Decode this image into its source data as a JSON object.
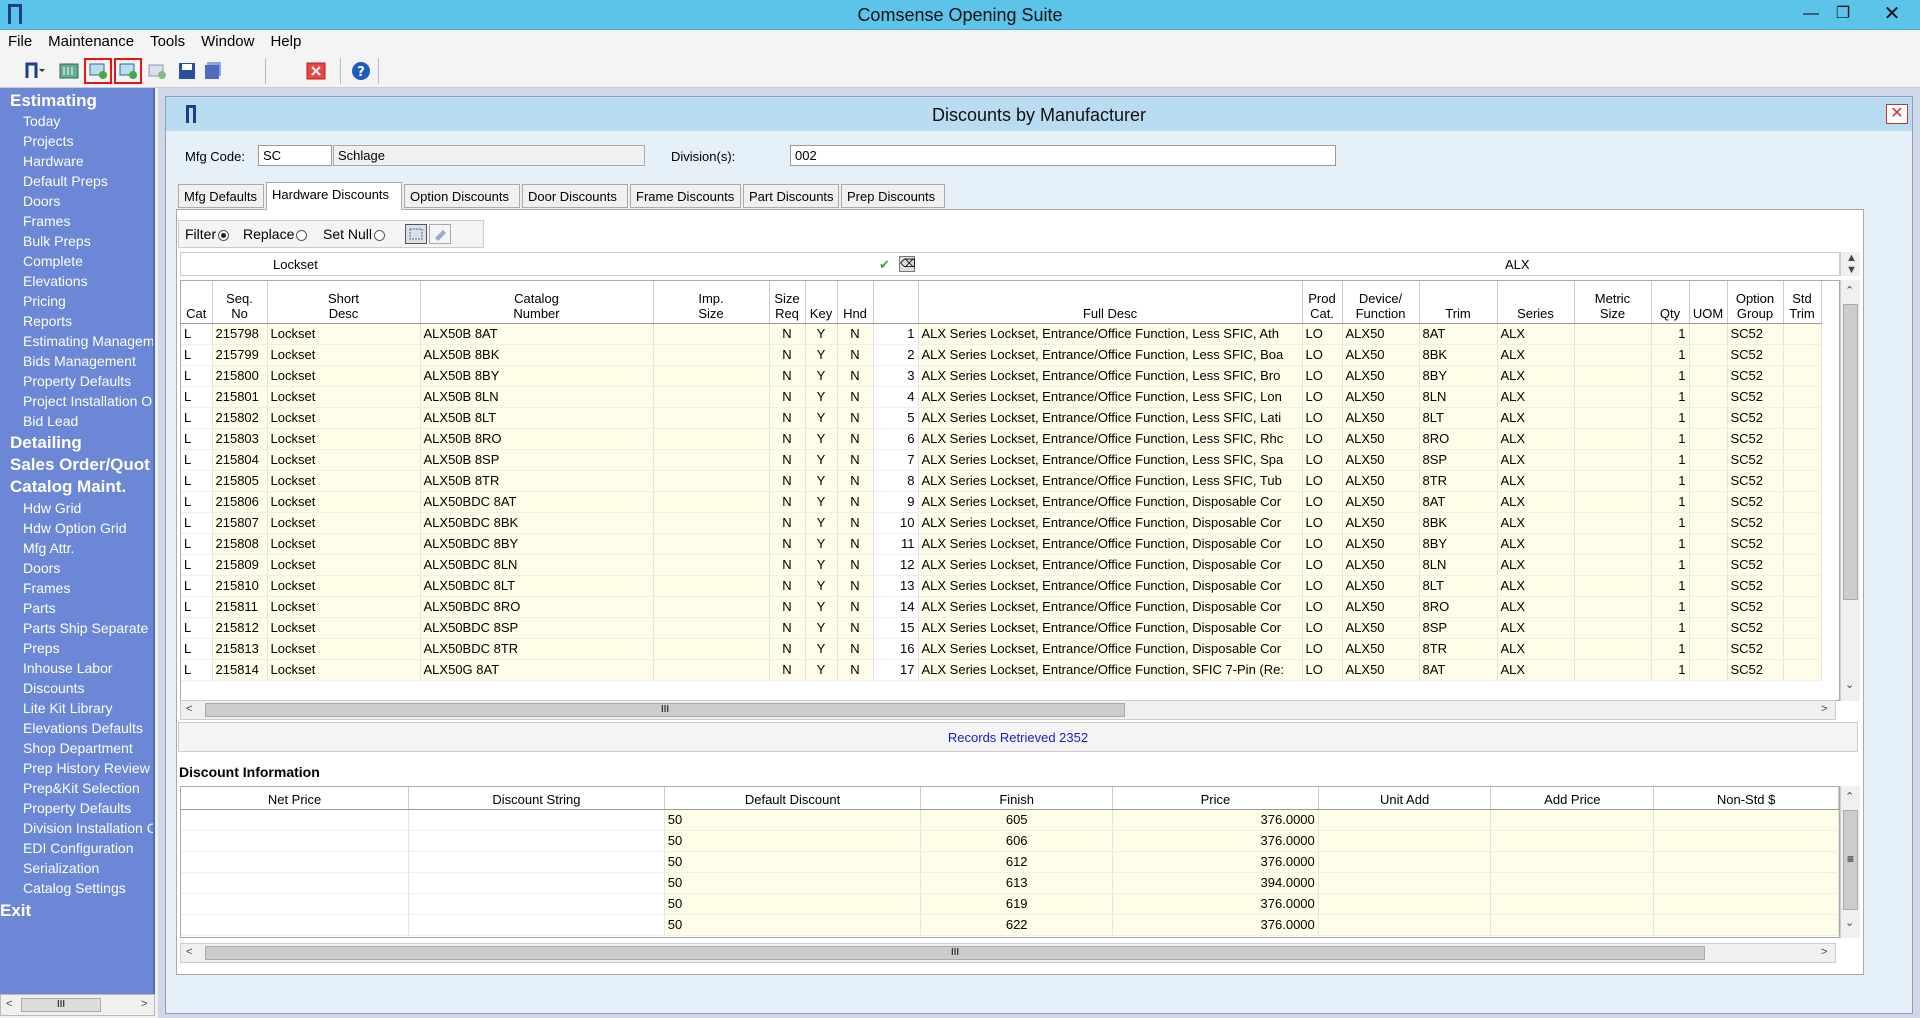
{
  "app": {
    "title": "Comsense Opening Suite"
  },
  "menu": [
    "File",
    "Maintenance",
    "Tools",
    "Window",
    "Help"
  ],
  "sidebar": {
    "estimating": {
      "label": "Estimating",
      "items": [
        "Today",
        "Projects",
        "Hardware",
        "Default Preps",
        "Doors",
        "Frames",
        "Bulk Preps",
        "Complete",
        "Elevations",
        "Pricing",
        "Reports",
        "Estimating Manageme",
        "Bids Management",
        "Property Defaults",
        "Project Installation O|",
        "Bid Lead"
      ]
    },
    "detailing": "Detailing",
    "sales": "Sales Order/Quot",
    "catalog": {
      "label": "Catalog Maint.",
      "items": [
        "Hdw Grid",
        "Hdw Option Grid",
        "Mfg Attr.",
        "Doors",
        "Frames",
        "Parts",
        "Parts Ship Separate",
        "Preps",
        "Inhouse Labor",
        "Discounts",
        "Lite Kit Library",
        "Elevations Defaults",
        "Shop Department",
        "Prep History Review",
        "Prep&Kit Selection",
        "Property Defaults",
        "Division Installation O",
        "EDI Configuration",
        "Serialization",
        "Catalog Settings"
      ]
    },
    "exit": "Exit"
  },
  "window": {
    "title": "Discounts by Manufacturer"
  },
  "form": {
    "mfg_code_label": "Mfg Code:",
    "mfg_code": "SC",
    "mfg_name": "Schlage",
    "division_label": "Division(s):",
    "division": "002"
  },
  "tabs": [
    "Mfg Defaults",
    "Hardware Discounts",
    "Option Discounts",
    "Door Discounts",
    "Frame Discounts",
    "Part Discounts",
    "Prep Discounts"
  ],
  "filterbar": {
    "filter": "Filter",
    "replace": "Replace",
    "setnull": "Set Null"
  },
  "filter_row": {
    "short_desc": "Lockset",
    "series": "ALX"
  },
  "grid": {
    "headers": [
      "Cat",
      "Seq.\nNo",
      "Short\nDesc",
      "Catalog\nNumber",
      "Imp.\nSize",
      "Size\nReq",
      "Key",
      "Hnd",
      "",
      "Full Desc",
      "Prod\nCat.",
      "Device/\nFunction",
      "Trim",
      "Series",
      "Metric\nSize",
      "Qty",
      "UOM",
      "Option\nGroup",
      "Std\nTrim"
    ],
    "rows": [
      [
        "L",
        "215798",
        "Lockset",
        "ALX50B 8AT",
        "",
        "N",
        "Y",
        "N",
        "1",
        "ALX Series Lockset, Entrance/Office Function, Less SFIC, Ath",
        "LO",
        "ALX50",
        "8AT",
        "ALX",
        "",
        "1",
        "",
        "SC52",
        ""
      ],
      [
        "L",
        "215799",
        "Lockset",
        "ALX50B 8BK",
        "",
        "N",
        "Y",
        "N",
        "2",
        "ALX Series Lockset, Entrance/Office Function, Less SFIC, Boa",
        "LO",
        "ALX50",
        "8BK",
        "ALX",
        "",
        "1",
        "",
        "SC52",
        ""
      ],
      [
        "L",
        "215800",
        "Lockset",
        "ALX50B 8BY",
        "",
        "N",
        "Y",
        "N",
        "3",
        "ALX Series Lockset, Entrance/Office Function, Less SFIC, Bro",
        "LO",
        "ALX50",
        "8BY",
        "ALX",
        "",
        "1",
        "",
        "SC52",
        ""
      ],
      [
        "L",
        "215801",
        "Lockset",
        "ALX50B 8LN",
        "",
        "N",
        "Y",
        "N",
        "4",
        "ALX Series Lockset, Entrance/Office Function, Less SFIC, Lon",
        "LO",
        "ALX50",
        "8LN",
        "ALX",
        "",
        "1",
        "",
        "SC52",
        ""
      ],
      [
        "L",
        "215802",
        "Lockset",
        "ALX50B 8LT",
        "",
        "N",
        "Y",
        "N",
        "5",
        "ALX Series Lockset, Entrance/Office Function, Less SFIC, Lati",
        "LO",
        "ALX50",
        "8LT",
        "ALX",
        "",
        "1",
        "",
        "SC52",
        ""
      ],
      [
        "L",
        "215803",
        "Lockset",
        "ALX50B 8RO",
        "",
        "N",
        "Y",
        "N",
        "6",
        "ALX Series Lockset, Entrance/Office Function, Less SFIC, Rhc",
        "LO",
        "ALX50",
        "8RO",
        "ALX",
        "",
        "1",
        "",
        "SC52",
        ""
      ],
      [
        "L",
        "215804",
        "Lockset",
        "ALX50B 8SP",
        "",
        "N",
        "Y",
        "N",
        "7",
        "ALX Series Lockset, Entrance/Office Function, Less SFIC, Spa",
        "LO",
        "ALX50",
        "8SP",
        "ALX",
        "",
        "1",
        "",
        "SC52",
        ""
      ],
      [
        "L",
        "215805",
        "Lockset",
        "ALX50B 8TR",
        "",
        "N",
        "Y",
        "N",
        "8",
        "ALX Series Lockset, Entrance/Office Function, Less SFIC, Tub",
        "LO",
        "ALX50",
        "8TR",
        "ALX",
        "",
        "1",
        "",
        "SC52",
        ""
      ],
      [
        "L",
        "215806",
        "Lockset",
        "ALX50BDC 8AT",
        "",
        "N",
        "Y",
        "N",
        "9",
        "ALX Series Lockset, Entrance/Office Function, Disposable Cor",
        "LO",
        "ALX50",
        "8AT",
        "ALX",
        "",
        "1",
        "",
        "SC52",
        ""
      ],
      [
        "L",
        "215807",
        "Lockset",
        "ALX50BDC 8BK",
        "",
        "N",
        "Y",
        "N",
        "10",
        "ALX Series Lockset, Entrance/Office Function, Disposable Cor",
        "LO",
        "ALX50",
        "8BK",
        "ALX",
        "",
        "1",
        "",
        "SC52",
        ""
      ],
      [
        "L",
        "215808",
        "Lockset",
        "ALX50BDC 8BY",
        "",
        "N",
        "Y",
        "N",
        "11",
        "ALX Series Lockset, Entrance/Office Function, Disposable Cor",
        "LO",
        "ALX50",
        "8BY",
        "ALX",
        "",
        "1",
        "",
        "SC52",
        ""
      ],
      [
        "L",
        "215809",
        "Lockset",
        "ALX50BDC 8LN",
        "",
        "N",
        "Y",
        "N",
        "12",
        "ALX Series Lockset, Entrance/Office Function, Disposable Cor",
        "LO",
        "ALX50",
        "8LN",
        "ALX",
        "",
        "1",
        "",
        "SC52",
        ""
      ],
      [
        "L",
        "215810",
        "Lockset",
        "ALX50BDC 8LT",
        "",
        "N",
        "Y",
        "N",
        "13",
        "ALX Series Lockset, Entrance/Office Function, Disposable Cor",
        "LO",
        "ALX50",
        "8LT",
        "ALX",
        "",
        "1",
        "",
        "SC52",
        ""
      ],
      [
        "L",
        "215811",
        "Lockset",
        "ALX50BDC 8RO",
        "",
        "N",
        "Y",
        "N",
        "14",
        "ALX Series Lockset, Entrance/Office Function, Disposable Cor",
        "LO",
        "ALX50",
        "8RO",
        "ALX",
        "",
        "1",
        "",
        "SC52",
        ""
      ],
      [
        "L",
        "215812",
        "Lockset",
        "ALX50BDC 8SP",
        "",
        "N",
        "Y",
        "N",
        "15",
        "ALX Series Lockset, Entrance/Office Function, Disposable Cor",
        "LO",
        "ALX50",
        "8SP",
        "ALX",
        "",
        "1",
        "",
        "SC52",
        ""
      ],
      [
        "L",
        "215813",
        "Lockset",
        "ALX50BDC 8TR",
        "",
        "N",
        "Y",
        "N",
        "16",
        "ALX Series Lockset, Entrance/Office Function, Disposable Cor",
        "LO",
        "ALX50",
        "8TR",
        "ALX",
        "",
        "1",
        "",
        "SC52",
        ""
      ],
      [
        "L",
        "215814",
        "Lockset",
        "ALX50G 8AT",
        "",
        "N",
        "Y",
        "N",
        "17",
        "ALX Series Lockset, Entrance/Office Function, SFIC 7-Pin (Re:",
        "LO",
        "ALX50",
        "8AT",
        "ALX",
        "",
        "1",
        "",
        "SC52",
        ""
      ]
    ]
  },
  "status": {
    "records": "Records Retrieved 2352"
  },
  "discount": {
    "title": "Discount Information",
    "headers": [
      "Net Price",
      "Discount String",
      "Default Discount",
      "Finish",
      "Price",
      "Unit Add",
      "Add Price",
      "Non-Std $"
    ],
    "rows": [
      [
        "",
        "",
        "50",
        "605",
        "376.0000",
        "",
        "",
        ""
      ],
      [
        "",
        "",
        "50",
        "606",
        "376.0000",
        "",
        "",
        ""
      ],
      [
        "",
        "",
        "50",
        "612",
        "376.0000",
        "",
        "",
        ""
      ],
      [
        "",
        "",
        "50",
        "613",
        "394.0000",
        "",
        "",
        ""
      ],
      [
        "",
        "",
        "50",
        "619",
        "376.0000",
        "",
        "",
        ""
      ],
      [
        "",
        "",
        "50",
        "622",
        "376.0000",
        "",
        "",
        ""
      ]
    ]
  },
  "scroll_glyph": "III"
}
